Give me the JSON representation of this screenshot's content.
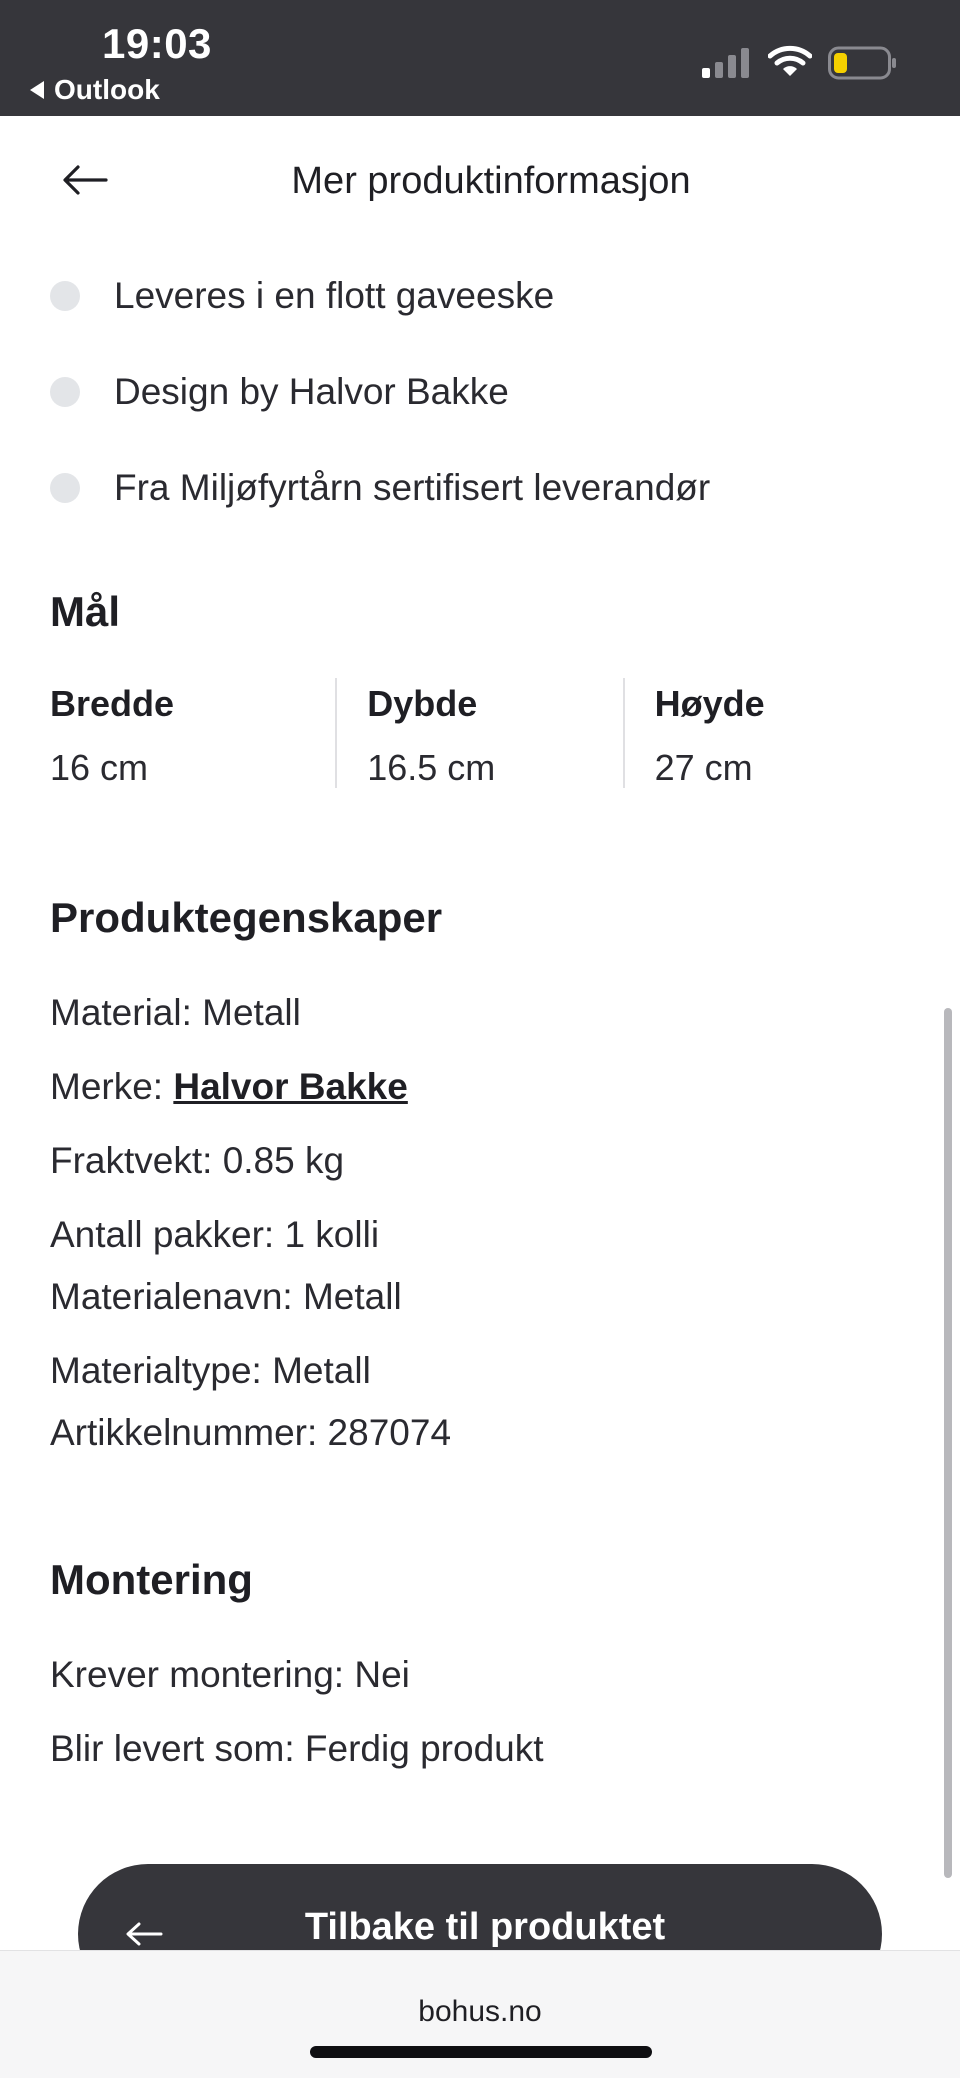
{
  "status_bar": {
    "time": "19:03",
    "back_app": "Outlook",
    "icons": [
      "cellular-signal-icon",
      "wifi-icon",
      "battery-low-icon"
    ],
    "battery_level": 0.2,
    "battery_color": "#f5d000"
  },
  "header": {
    "title": "Mer produktinformasjon",
    "back_icon": "arrow-left-icon"
  },
  "bullets": [
    "Leveres i en flott gaveeske",
    "Design by Halvor Bakke",
    "Fra Miljøfyrtårn sertifisert leverandør"
  ],
  "dimensions": {
    "title": "Mål",
    "width_label": "Bredde",
    "width_value": "16 cm",
    "depth_label": "Dybde",
    "depth_value": "16.5 cm",
    "height_label": "Høyde",
    "height_value": "27 cm"
  },
  "properties": {
    "title": "Produktegenskaper",
    "material": "Material: Metall",
    "brand_prefix": "Merke: ",
    "brand_link": "Halvor Bakke",
    "shipping_weight": "Fraktvekt: 0.85 kg",
    "packages": "Antall pakker: 1 kolli",
    "material_name": "Materialenavn: Metall",
    "material_type": "Materialtype: Metall",
    "article_number": "Artikkelnummer: 287074"
  },
  "assembly": {
    "title": "Montering",
    "requires_assembly": "Krever montering: Nei",
    "delivered_as": "Blir levert som: Ferdig produkt"
  },
  "back_button": {
    "label": "Tilbake til produktet"
  },
  "browser": {
    "url": "bohus.no"
  },
  "colors": {
    "dark": "#36363b",
    "text": "#1f1f24",
    "bullet_dot": "#e3e5e8"
  }
}
